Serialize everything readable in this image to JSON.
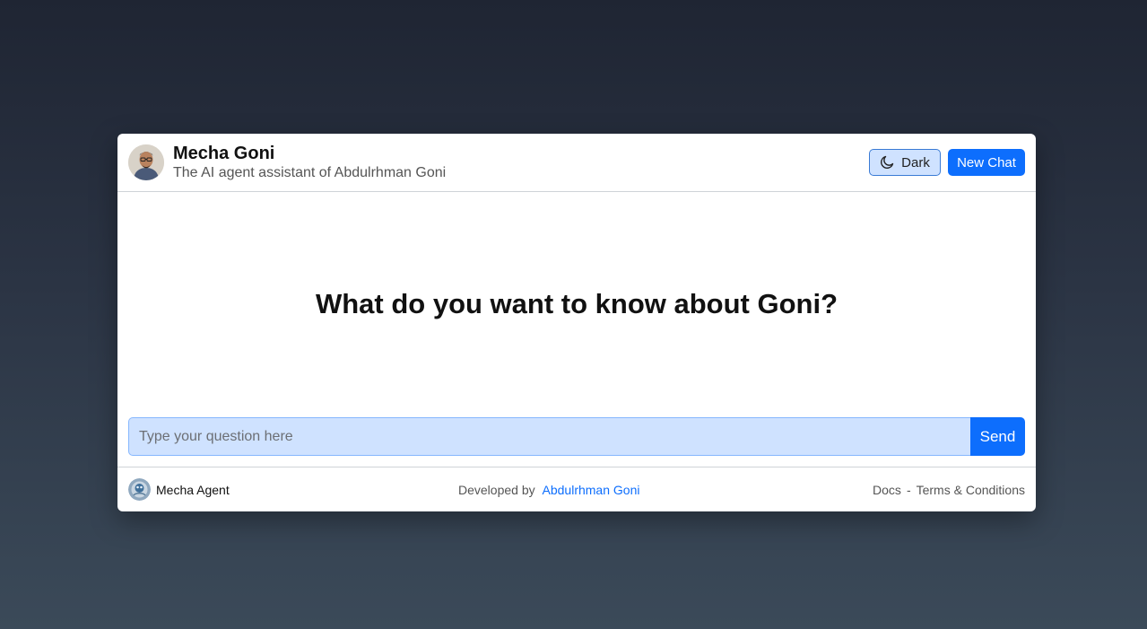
{
  "header": {
    "title": "Mecha Goni",
    "subtitle": "The AI agent assistant of Abdulrhman Goni",
    "avatar_icon": "person-avatar",
    "theme_button_icon": "moon-icon",
    "theme_button_label": "Dark",
    "new_chat_label": "New Chat"
  },
  "main": {
    "prompt": "What do you want to know about Goni?"
  },
  "composer": {
    "placeholder": "Type your question here",
    "value": "",
    "send_label": "Send"
  },
  "footer": {
    "agent_logo_icon": "agent-logo",
    "agent_name": "Mecha Agent",
    "developed_by": "Developed by",
    "developer_name": "Abdulrhman Goni",
    "docs_label": "Docs",
    "separator": "-",
    "terms_label": "Terms & Conditions"
  },
  "colors": {
    "primary": "#0d6efd",
    "input_bg": "#cfe2ff",
    "background_top": "#1f2533",
    "background_bottom": "#3b4a59"
  }
}
